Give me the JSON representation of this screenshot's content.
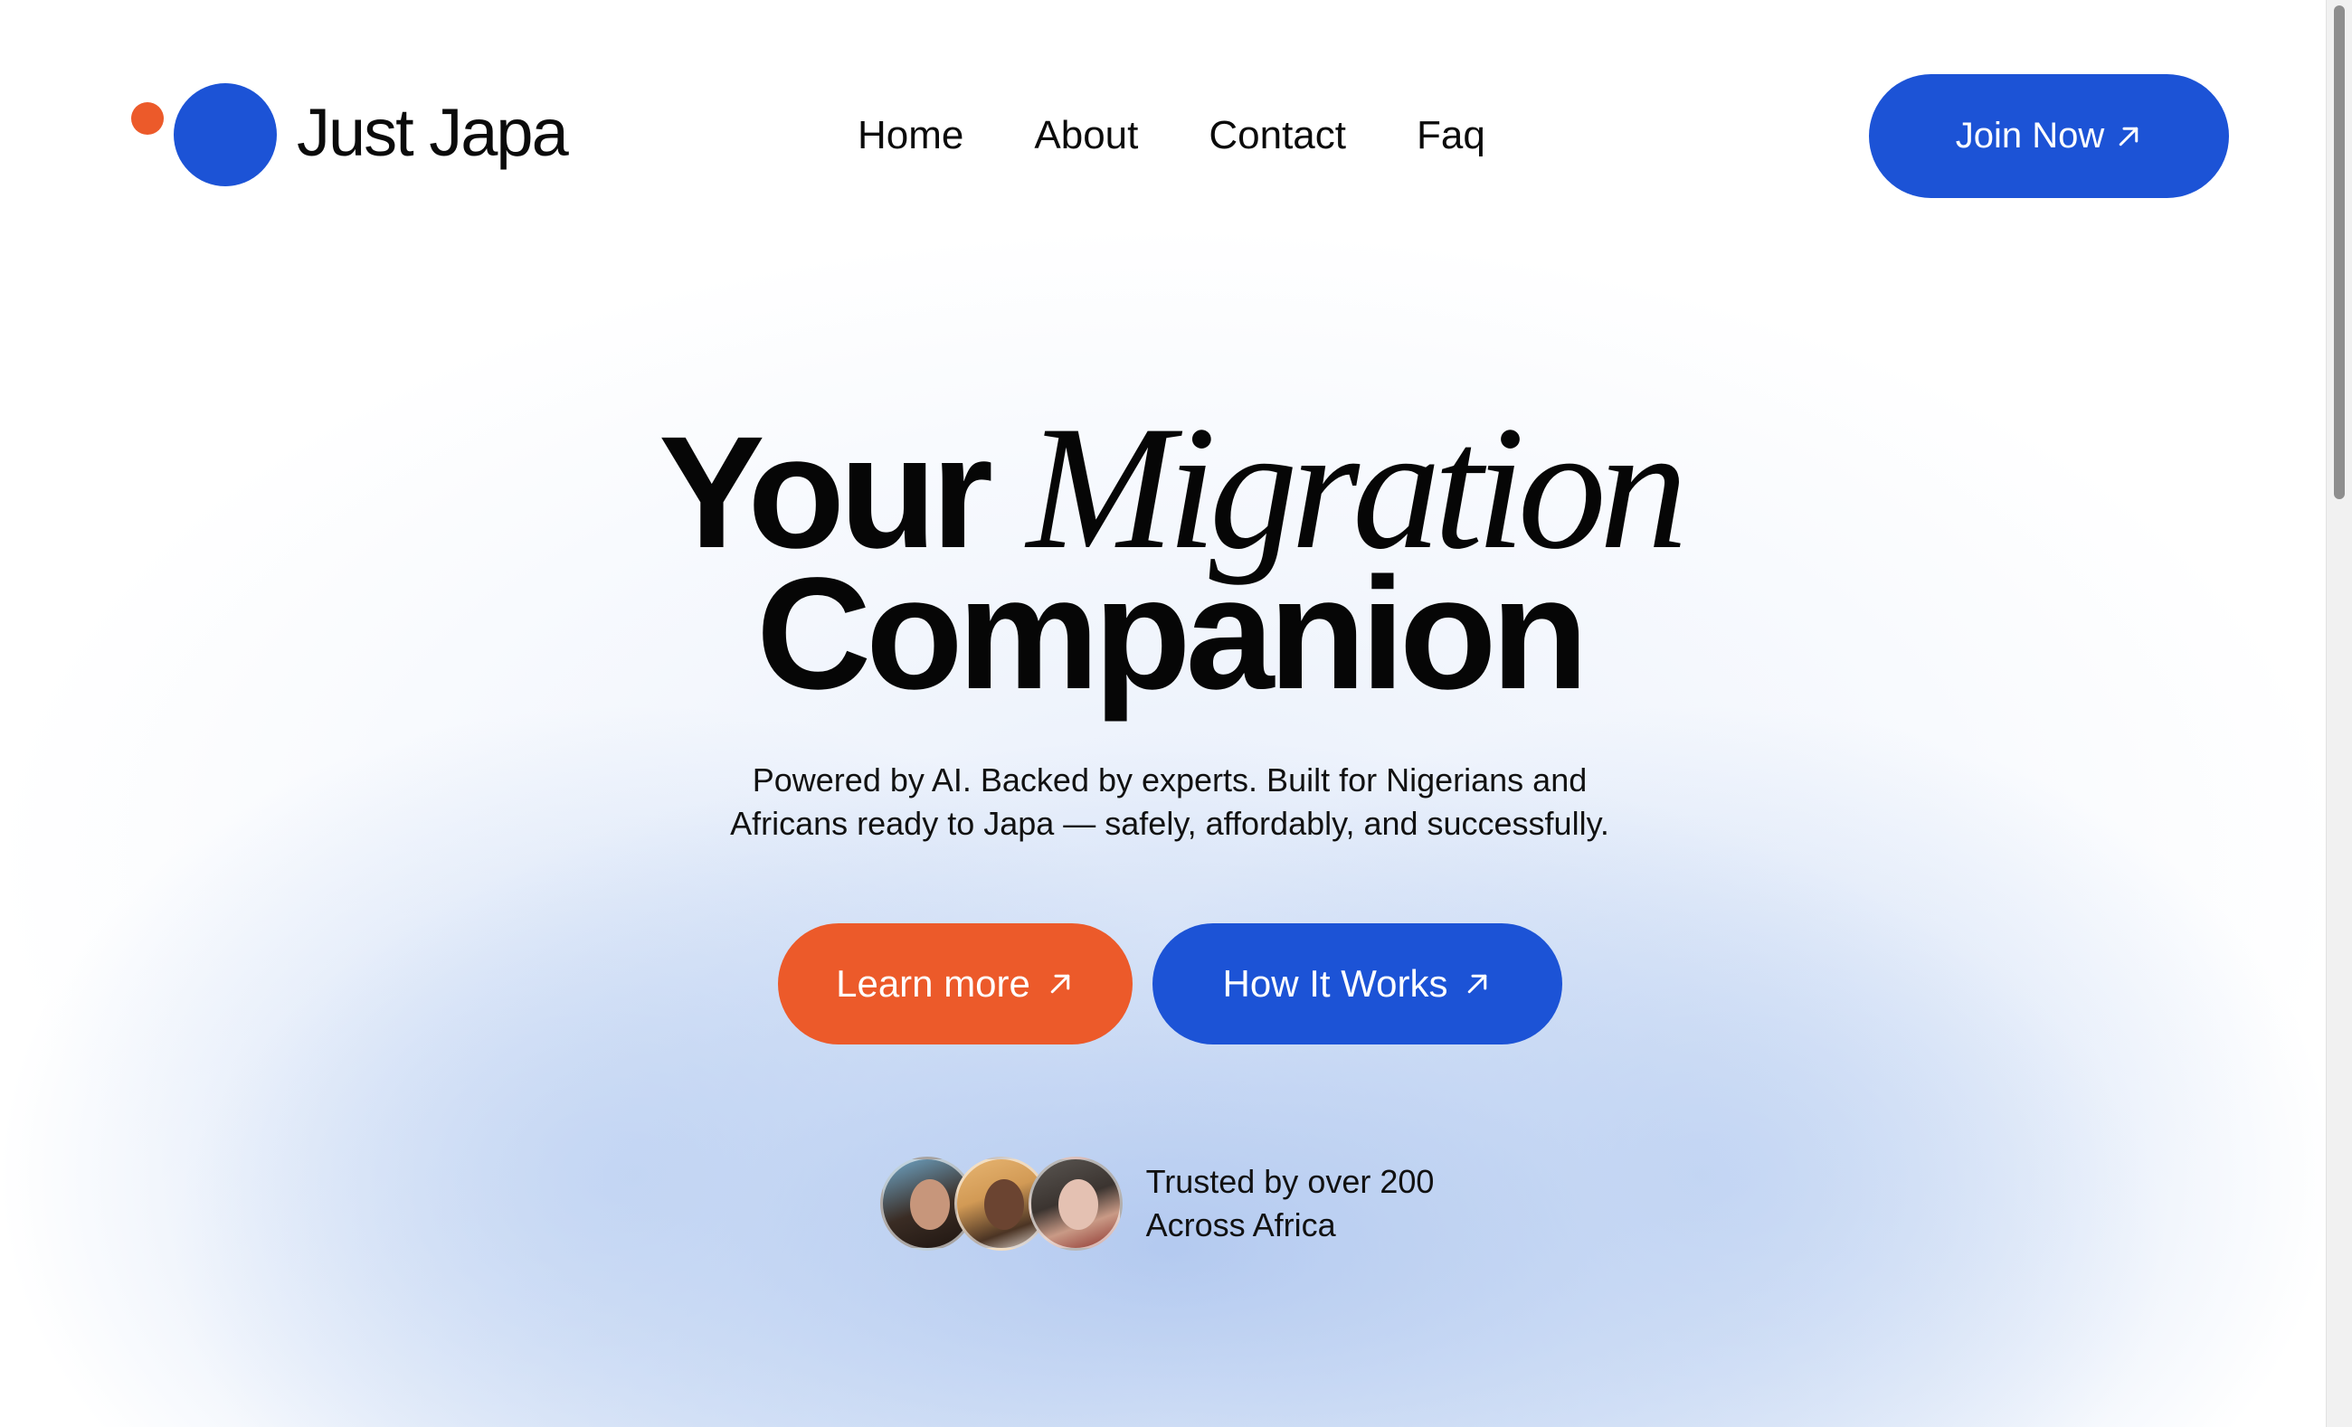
{
  "brand": {
    "name": "Just Japa",
    "colors": {
      "primary_blue": "#1c53d6",
      "accent_orange": "#ec5a2a"
    }
  },
  "nav": {
    "items": [
      {
        "label": "Home"
      },
      {
        "label": "About"
      },
      {
        "label": "Contact"
      },
      {
        "label": "Faq"
      }
    ],
    "join_label": "Join Now",
    "join_icon": "arrow-up-right-icon"
  },
  "hero": {
    "headline_word1": "Your",
    "headline_word2": "Migration",
    "headline_line2": "Companion",
    "subtext_line1": "Powered by AI. Backed by experts. Built for Nigerians and",
    "subtext_line2": "Africans ready to Japa — safely, affordably, and successfully.",
    "learn_more_label": "Learn more",
    "how_it_works_label": "How It Works",
    "button_icon": "arrow-up-right-icon"
  },
  "trust": {
    "line1": "Trusted by over 200",
    "line2": "Across Africa",
    "avatar_count": 3
  }
}
